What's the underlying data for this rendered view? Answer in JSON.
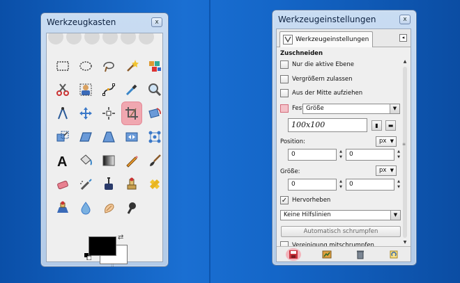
{
  "toolbox": {
    "title": "Werkzeugkasten",
    "close_label": "x",
    "swap_glyph": "⇄",
    "dots": "::",
    "tools": [
      {
        "name": "rect-select-icon"
      },
      {
        "name": "ellipse-select-icon"
      },
      {
        "name": "lasso-select-icon"
      },
      {
        "name": "fuzzy-select-icon"
      },
      {
        "name": "color-select-icon"
      },
      {
        "name": "scissors-select-icon"
      },
      {
        "name": "foreground-select-icon"
      },
      {
        "name": "paths-icon"
      },
      {
        "name": "color-picker-icon"
      },
      {
        "name": "zoom-icon"
      },
      {
        "name": "measure-icon"
      },
      {
        "name": "move-icon"
      },
      {
        "name": "align-icon"
      },
      {
        "name": "crop-icon",
        "active": true
      },
      {
        "name": "rotate-icon"
      },
      {
        "name": "scale-icon"
      },
      {
        "name": "shear-icon"
      },
      {
        "name": "perspective-icon"
      },
      {
        "name": "flip-icon"
      },
      {
        "name": "cage-transform-icon"
      },
      {
        "name": "text-icon"
      },
      {
        "name": "bucket-fill-icon"
      },
      {
        "name": "blend-icon"
      },
      {
        "name": "pencil-icon"
      },
      {
        "name": "paintbrush-icon"
      },
      {
        "name": "eraser-icon"
      },
      {
        "name": "airbrush-icon"
      },
      {
        "name": "ink-icon"
      },
      {
        "name": "clone-icon"
      },
      {
        "name": "heal-icon"
      },
      {
        "name": "perspective-clone-icon"
      },
      {
        "name": "blur-icon"
      },
      {
        "name": "smudge-icon"
      },
      {
        "name": "dodge-burn-icon"
      }
    ],
    "colors": {
      "fg": "#000000",
      "bg": "#ffffff",
      "active": "#f0a7b0"
    }
  },
  "tool_options": {
    "title": "Werkzeugeinstellungen",
    "close_label": "x",
    "tab_label": "Werkzeugeinstellungen",
    "section": "Zuschneiden",
    "opt_active_layer": "Nur die aktive Ebene",
    "opt_allow_grow": "Vergrößern zulassen",
    "opt_from_center": "Aus der Mitte aufziehen",
    "fixed_label": "Fest:",
    "fixed_mode": "Größe",
    "size_value": "100x100",
    "position_label": "Position:",
    "position_unit": "px",
    "position_x": "0",
    "position_y": "0",
    "size_label": "Größe:",
    "size_unit": "px",
    "size_w": "0",
    "size_h": "0",
    "highlight_label": "Hervorheben",
    "guides": "Keine Hilfslinien",
    "auto_shrink": "Automatisch schrumpfen",
    "shrink_merged": "Vereinigung mitschrumpfen",
    "bottom_buttons": [
      "save-options-icon",
      "restore-options-icon",
      "delete-options-icon",
      "reset-options-icon"
    ]
  }
}
